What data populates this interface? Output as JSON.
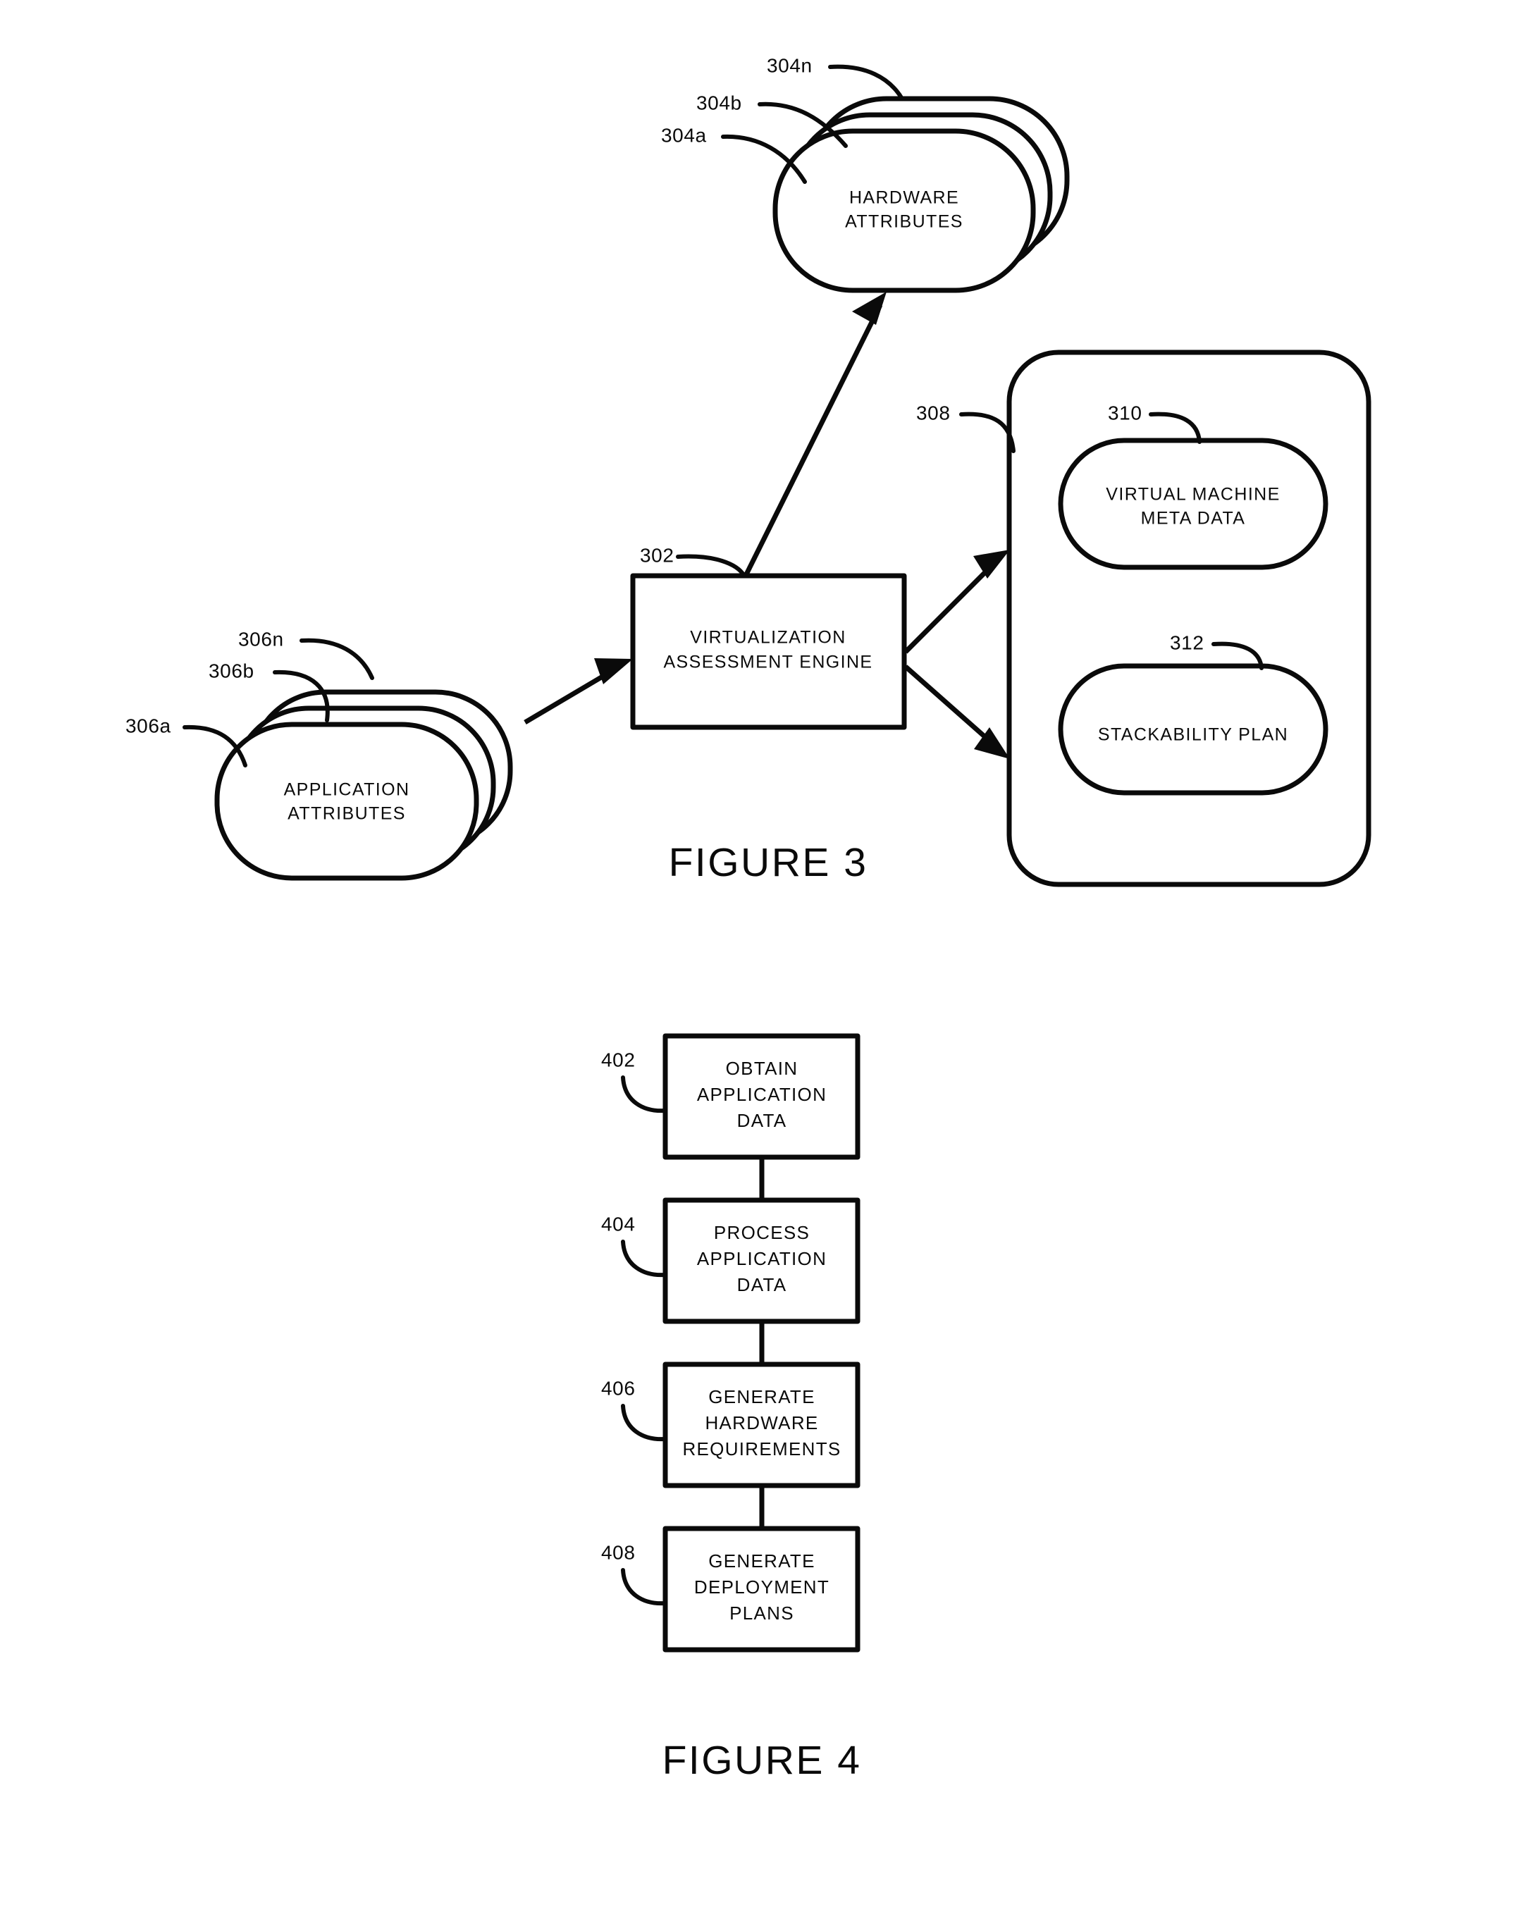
{
  "document": {
    "type": "patent-drawing-sheet",
    "background_color": "#ffffff",
    "ink_color": "#0a0a0a"
  },
  "figure3": {
    "caption": "FIGURE 3",
    "engine": {
      "ref": "302",
      "label_line1": "VIRTUALIZATION",
      "label_line2": "ASSESSMENT ENGINE"
    },
    "hardware_attributes": {
      "label_line1": "HARDWARE",
      "label_line2": "ATTRIBUTES",
      "refs": [
        "304a",
        "304b",
        "304n"
      ],
      "stack_count": 3
    },
    "application_attributes": {
      "label_line1": "APPLICATION",
      "label_line2": "ATTRIBUTES",
      "refs": [
        "306a",
        "306b",
        "306n"
      ],
      "stack_count": 3
    },
    "output_container": {
      "ref": "308",
      "items": [
        {
          "ref": "310",
          "label_line1": "VIRTUAL MACHINE",
          "label_line2": "META DATA"
        },
        {
          "ref": "312",
          "label_line1": "STACKABILITY PLAN",
          "label_line2": ""
        }
      ]
    }
  },
  "figure4": {
    "caption": "FIGURE 4",
    "steps": [
      {
        "ref": "402",
        "lines": [
          "OBTAIN",
          "APPLICATION",
          "DATA"
        ]
      },
      {
        "ref": "404",
        "lines": [
          "PROCESS",
          "APPLICATION",
          "DATA"
        ]
      },
      {
        "ref": "406",
        "lines": [
          "GENERATE",
          "HARDWARE",
          "REQUIREMENTS"
        ]
      },
      {
        "ref": "408",
        "lines": [
          "GENERATE",
          "DEPLOYMENT",
          "PLANS"
        ]
      }
    ]
  }
}
